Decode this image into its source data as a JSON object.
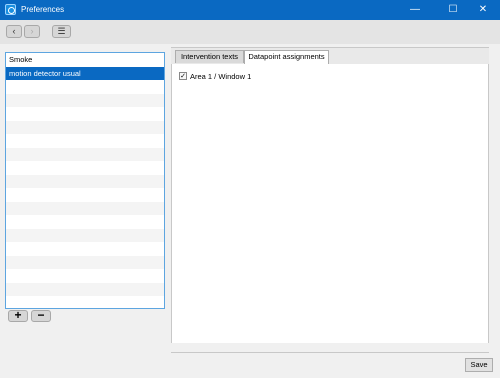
{
  "window": {
    "title": "Preferences",
    "minimize_glyph": "—",
    "maximize_glyph": "☐",
    "close_glyph": "✕"
  },
  "toolbar": {
    "back_glyph": "‹",
    "forward_glyph": "›",
    "menu_glyph": "☰"
  },
  "list": {
    "items": [
      {
        "label": "Smoke"
      },
      {
        "label": "motion detector usual",
        "selected": true
      }
    ],
    "add_glyph": "+",
    "remove_glyph": "−"
  },
  "tabs": [
    {
      "label": "Intervention texts",
      "active": false
    },
    {
      "label": "Datapoint assignments",
      "active": true
    }
  ],
  "datapoints": [
    {
      "label": "Area 1 / Window 1",
      "checked": true,
      "check_glyph": "✓"
    }
  ],
  "footer": {
    "save_label": "Save"
  },
  "colors": {
    "title_bar": "#0a69c2",
    "selection": "#0a69c2",
    "list_border": "#5da5e0"
  }
}
